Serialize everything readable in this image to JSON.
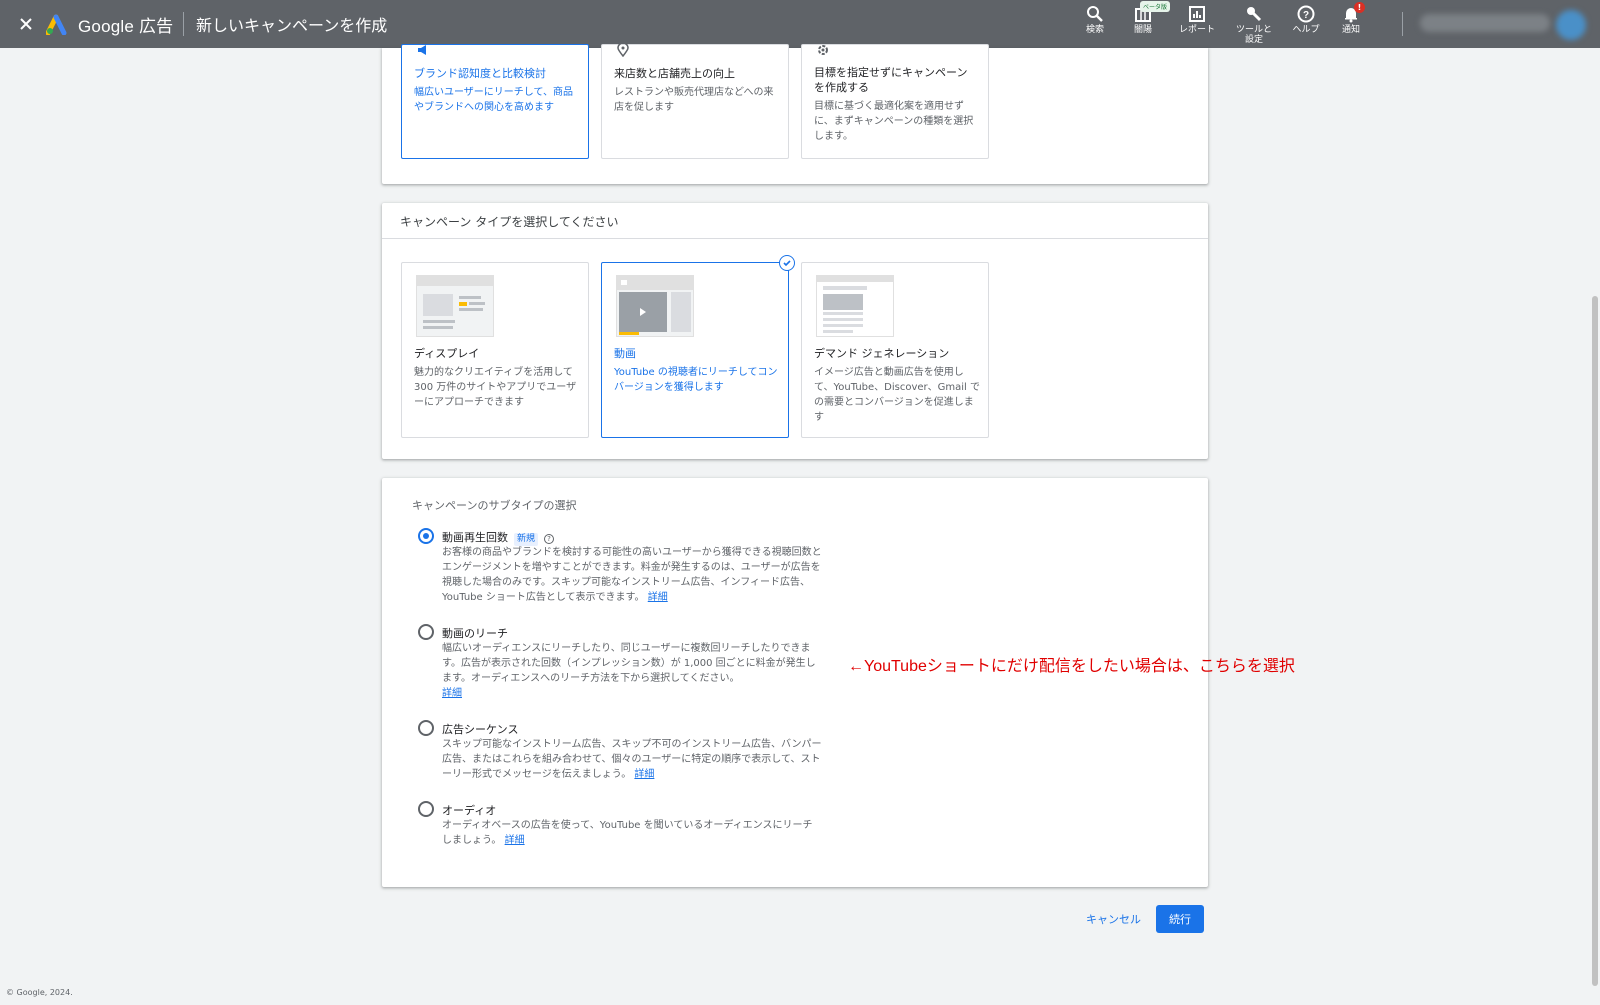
{
  "topbar": {
    "brand": "Google 広告",
    "page_title": "新しいキャンペーンを作成",
    "tools": [
      {
        "label": "検索",
        "icon": "search-icon"
      },
      {
        "label": "闇陽",
        "icon": "columns-icon"
      },
      {
        "label": "レポート",
        "icon": "report-icon"
      },
      {
        "label": "ツールと\n設定",
        "icon": "wrench-icon"
      },
      {
        "label": "ヘルプ",
        "icon": "help-icon"
      },
      {
        "label": "通知",
        "icon": "bell-icon"
      }
    ],
    "beta_badge": "ベータ版",
    "notif_count": "!"
  },
  "objectives": [
    {
      "title": "ブランド認知度と比較検討",
      "desc": "幅広いユーザーにリーチして、商品やブランドへの関心を高めます",
      "icon": "megaphone-icon",
      "selected": true
    },
    {
      "title": "来店数と店舗売上の向上",
      "desc": "レストランや販売代理店などへの来店を促します",
      "icon": "location-pin-icon",
      "selected": false
    },
    {
      "title": "目標を指定せずにキャンペーンを作成する",
      "desc": "目標に基づく最適化案を適用せずに、まずキャンペーンの種類を選択します。",
      "icon": "gear-icon",
      "selected": false
    }
  ],
  "campaign_types": {
    "header": "キャンペーン タイプを選択してください",
    "items": [
      {
        "title": "ディスプレイ",
        "desc": "魅力的なクリエイティブを活用して 300 万件のサイトやアプリでユーザーにアプローチできます",
        "selected": false
      },
      {
        "title": "動画",
        "desc": "YouTube の視聴者にリーチしてコンバージョンを獲得します",
        "selected": true
      },
      {
        "title": "デマンド ジェネレーション",
        "desc": "イメージ広告と動画広告を使用して、YouTube、Discover、Gmail での需要とコンバージョンを促進します",
        "selected": false
      }
    ]
  },
  "subtypes": {
    "title": "キャンペーンのサブタイプの選択",
    "new_badge": "新規",
    "link_label": "詳細",
    "options": [
      {
        "title": "動画再生回数",
        "desc": "お客様の商品やブランドを検討する可能性の高いユーザーから獲得できる視聴回数とエンゲージメントを増やすことができます。料金が発生するのは、ユーザーが広告を視聴した場合のみです。スキップ可能なインストリーム広告、インフィード広告、YouTube ショート広告として表示できます。",
        "selected": true
      },
      {
        "title": "動画のリーチ",
        "desc": "幅広いオーディエンスにリーチしたり、同じユーザーに複数回リーチしたりできます。広告が表示された回数（インプレッション数）が 1,000 回ごとに料金が発生します。オーディエンスへのリーチ方法を下から選択してください。",
        "selected": false
      },
      {
        "title": "広告シーケンス",
        "desc": "スキップ可能なインストリーム広告、スキップ不可のインストリーム広告、バンパー広告、またはこれらを組み合わせて、個々のユーザーに特定の順序で表示して、ストーリー形式でメッセージを伝えましょう。",
        "selected": false
      },
      {
        "title": "オーディオ",
        "desc": "オーディオベースの広告を使って、YouTube を聞いているオーディエンスにリーチしましょう。",
        "selected": false
      }
    ]
  },
  "annotation": "←YouTubeショートにだけ配信をしたい場合は、こちらを選択",
  "actions": {
    "cancel": "キャンセル",
    "continue": "続行"
  },
  "footer": "© Google, 2024.",
  "colors": {
    "topbar": "#5f6368",
    "accent": "#1a73e8",
    "annotation": "#e00000"
  }
}
